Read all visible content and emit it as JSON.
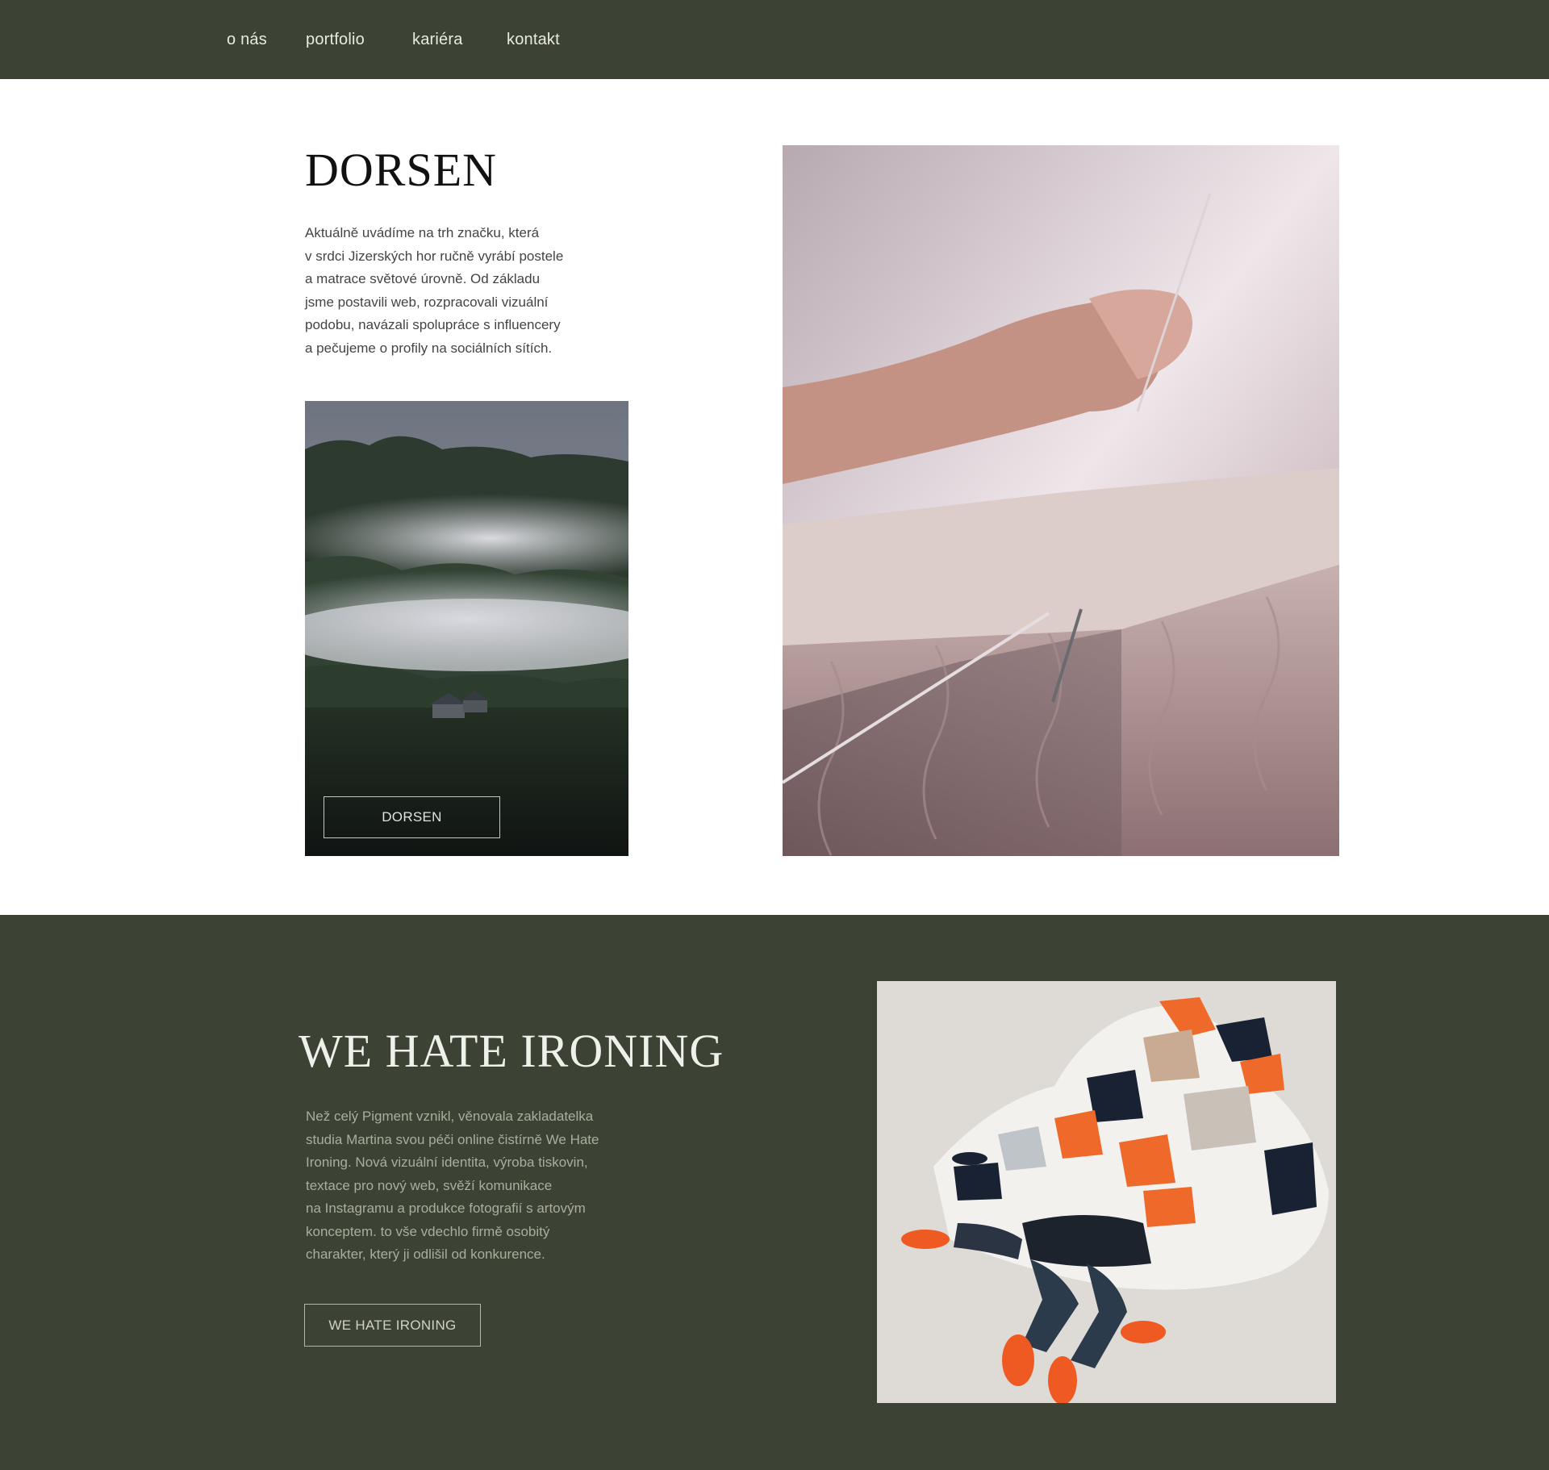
{
  "nav": {
    "items": [
      {
        "label": "o nás"
      },
      {
        "label": "portfolio"
      },
      {
        "label": "kariéra"
      },
      {
        "label": "kontakt"
      }
    ]
  },
  "colors": {
    "dark_green": "#3c4234",
    "white": "#ffffff"
  },
  "projects": [
    {
      "title": "DORSEN",
      "description": "Aktuálně uvádíme na trh značku, která\nv srdci Jizerských hor ručně vyrábí postele\na matrace světové úrovně. Od základu\njsme postavili web, rozpracovali vizuální\npodobu, navázali spolupráce s influencery\na pečujeme o profily na sociálních sítích.",
      "button_label": "DORSEN"
    },
    {
      "title": "WE HATE IRONING",
      "description": "Než celý Pigment vznikl, věnovala zakladatelka\nstudia Martina svou péči online čistírně We Hate\nIroning. Nová vizuální identita, výroba tiskovin,\ntextace pro nový web, svěží komunikace\nna Instagramu a produkce fotografií s artovým\nkonceptem. to vše vdechlo firmě osobitý\ncharakter, který ji odlišil od konkurence.",
      "button_label": "WE HATE IRONING"
    }
  ]
}
